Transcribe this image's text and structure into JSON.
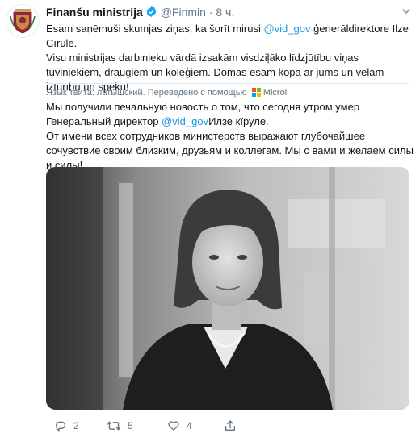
{
  "tweet": {
    "author_name": "Finanšu ministrija",
    "handle": "@Finmin",
    "separator": "·",
    "time": "8 ч.",
    "text_part1": "Esam saņēmuši skumjas ziņas, ka šorīt mirusi ",
    "mention_1": "@vid_gov",
    "text_part2": " ģenerāldirektore Ilze Cīrule.",
    "text_line3": "Visu ministrijas darbinieku vārdā izsakām visdziļāko līdzjūtību viņas tuviniekiem, draugiem un kolēģiem. Domās esam kopā ar jums un vēlam izturību un spēku!"
  },
  "translation_bar": {
    "label": "Язык твита: латышский. Переведено с помощью",
    "provider": "Microi"
  },
  "translation": {
    "text_part1": "Мы получили печальную новость о том, что сегодня утром умер Генеральный директор ",
    "mention": "@vid_gov",
    "text_part2": "Илзе кїруле.",
    "text_line3": "От имени всех сотрудников министерств выражают глубочайшее сочувствие своим близким, друзьям и коллегам. Мы с вами и желаем силы и силы!"
  },
  "actions": {
    "reply_count": "2",
    "retweet_count": "5",
    "like_count": "4"
  },
  "icons": {
    "verified": "verified-badge-icon",
    "menu": "chevron-down-icon",
    "reply": "reply-icon",
    "retweet": "retweet-icon",
    "like": "heart-icon",
    "share": "share-icon",
    "microsoft": "microsoft-logo-icon"
  },
  "colors": {
    "accent": "#1b95e0",
    "muted": "#657786",
    "text": "#14171a",
    "crest_red": "#9b2335"
  }
}
